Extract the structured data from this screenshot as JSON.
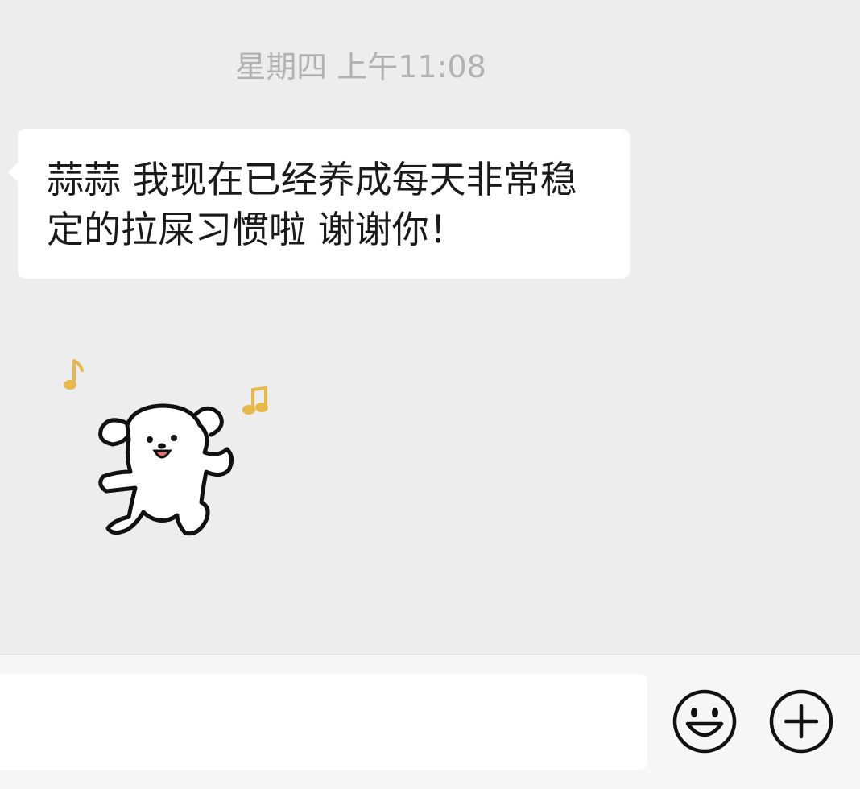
{
  "chat": {
    "timestamp": "星期四 上午11:08",
    "messages": [
      {
        "text": "蒜蒜 我现在已经养成每天非常稳定的拉屎习惯啦 谢谢你！"
      }
    ],
    "sticker": {
      "icon": "dancing-dog-sticker",
      "colors": {
        "notes": "#e8b94a",
        "outline": "#111111",
        "body": "#ffffff",
        "mouth": "#e57373"
      }
    }
  },
  "input_bar": {
    "input_value": "",
    "emoji_icon": "smiley-face-icon",
    "plus_icon": "plus-circle-icon"
  }
}
